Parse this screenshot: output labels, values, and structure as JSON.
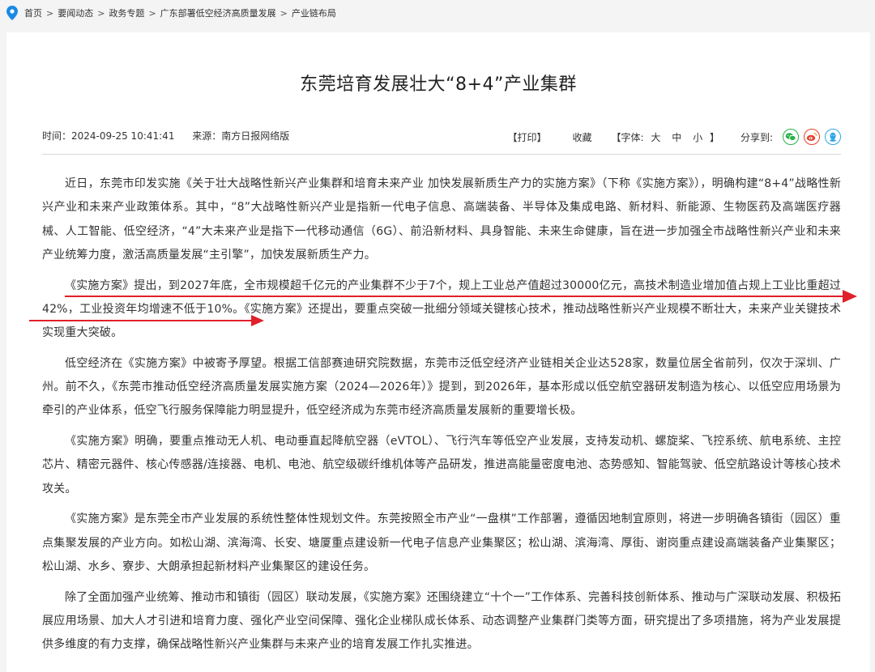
{
  "breadcrumb": {
    "items": [
      "首页",
      "要闻动态",
      "政务专题",
      "广东部署低空经济高质量发展",
      "产业链布局"
    ],
    "separator": ">"
  },
  "article": {
    "title": "东莞培育发展壮大“8+4”产业集群",
    "meta": {
      "time": "时间：2024-09-25 10:41:41",
      "source": "来源：南方日报网络版",
      "print_label": "【打印】",
      "favorite_label": "收藏",
      "font_prefix": "【字体:",
      "font_large": "大",
      "font_medium": "中",
      "font_small": "小",
      "font_suffix": "】",
      "share_label": "分享到:"
    },
    "paragraphs": [
      "近日，东莞市印发实施《关于壮大战略性新兴产业集群和培育未来产业 加快发展新质生产力的实施方案》（下称《实施方案》），明确构建“8+4”战略性新兴产业和未来产业政策体系。其中，“8”大战略性新兴产业是指新一代电子信息、高端装备、半导体及集成电路、新材料、新能源、生物医药及高端医疗器械、人工智能、低空经济，“4”大未来产业是指下一代移动通信（6G）、前沿新材料、具身智能、未来生命健康，旨在进一步加强全市战略性新兴产业和未来产业统筹力度，激活高质量发展“主引擎”，加快发展新质生产力。",
      "《实施方案》提出，到2027年底，全市规模超千亿元的产业集群不少于7个，规上工业总产值超过30000亿元，高技术制造业增加值占规上工业比重超过42%，工业投资年均增速不低于10%。《实施方案》还提出，要重点突破一批细分领域关键核心技术，推动战略性新兴产业规模不断壮大，未来产业关键技术实现重大突破。",
      "低空经济在《实施方案》中被寄予厚望。根据工信部赛迪研究院数据，东莞市泛低空经济产业链相关企业达528家，数量位居全省前列，仅次于深圳、广州。前不久，《东莞市推动低空经济高质量发展实施方案（2024—2026年）》提到，到2026年，基本形成以低空航空器研发制造为核心、以低空应用场景为牵引的产业体系，低空飞行服务保障能力明显提升，低空经济成为东莞市经济高质量发展新的重要增长极。",
      "《实施方案》明确，要重点推动无人机、电动垂直起降航空器（eVTOL）、飞行汽车等低空产业发展，支持发动机、螺旋桨、飞控系统、航电系统、主控芯片、精密元器件、核心传感器/连接器、电机、电池、航空级碳纤维机体等产品研发，推进高能量密度电池、态势感知、智能驾驶、低空航路设计等核心技术攻关。",
      "《实施方案》是东莞全市产业发展的系统性整体性规划文件。东莞按照全市产业“一盘棋”工作部署，遵循因地制宜原则，将进一步明确各镇街（园区）重点集聚发展的产业方向。如松山湖、滨海湾、长安、塘厦重点建设新一代电子信息产业集聚区；松山湖、滨海湾、厚街、谢岗重点建设高端装备产业集聚区；松山湖、水乡、寮步、大朗承担起新材料产业集聚区的建设任务。",
      "除了全面加强产业统筹、推动市和镇街（园区）联动发展，《实施方案》还围绕建立“十个一”工作体系、完善科技创新体系、推动与广深联动发展、积极拓展应用场景、加大人才引进和培育力度、强化产业空间保障、强化企业梯队成长体系、动态调整产业集群门类等方面，研究提出了多项措施，将为产业发展提供多维度的有力支撑，确保战略性新兴产业集群与未来产业的培育发展工作扎实推进。"
    ]
  },
  "colors": {
    "accent_blue": "#1c8ae5",
    "arrow_red": "#e0202a",
    "wechat_green": "#2bb24c",
    "weibo_red": "#e6432e",
    "qq_blue": "#2da6e6"
  }
}
